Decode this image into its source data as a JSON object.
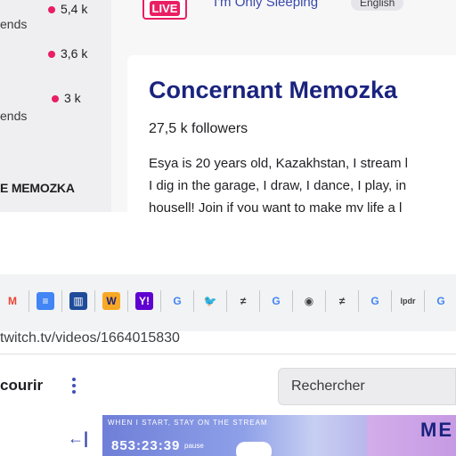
{
  "sidebar": {
    "channels": [
      {
        "viewers": "5,4 k",
        "label": "ends"
      },
      {
        "viewers": "3,6 k"
      },
      {
        "viewers": "3 k",
        "label": "ends"
      }
    ],
    "section_heading": "E MEMOZKA"
  },
  "stream": {
    "live_badge": "LIVE",
    "title": "I'm Only Sleeping",
    "language": "English"
  },
  "about": {
    "heading": "Concernant Memozka",
    "followers": "27,5 k followers",
    "bio_lines": [
      "Esya is 20 years old, Kazakhstan, I stream l",
      "I dig in the garage, I draw, I dance, I play, in",
      "housell! Join if you want to make my life a l"
    ]
  },
  "bookmarks": [
    {
      "icon": "gmail-icon",
      "glyph": "M",
      "color": "#ea4335",
      "bg": "transparent"
    },
    {
      "icon": "docs-icon",
      "glyph": "≡",
      "color": "#ffffff",
      "bg": "#4285f4"
    },
    {
      "icon": "trello-icon",
      "glyph": "▥",
      "color": "#ffffff",
      "bg": "#1e4c9a"
    },
    {
      "icon": "bookmark-w-icon",
      "glyph": "W",
      "color": "#1a237e",
      "bg": "#f9a825"
    },
    {
      "icon": "yahoo-icon",
      "glyph": "Y!",
      "color": "#ffffff",
      "bg": "#5f01d1"
    },
    {
      "icon": "google-icon",
      "glyph": "G",
      "color": "#4285f4",
      "bg": "transparent"
    },
    {
      "icon": "twitter-icon",
      "glyph": "🐦",
      "color": "#1da1f2",
      "bg": "transparent"
    },
    {
      "icon": "not-equal-icon",
      "glyph": "≠",
      "color": "#3c4043",
      "bg": "transparent"
    },
    {
      "icon": "google-icon",
      "glyph": "G",
      "color": "#4285f4",
      "bg": "transparent"
    },
    {
      "icon": "globe-icon",
      "glyph": "◉",
      "color": "#3c4043",
      "bg": "transparent"
    },
    {
      "icon": "not-equal-icon",
      "glyph": "≠",
      "color": "#3c4043",
      "bg": "transparent"
    },
    {
      "icon": "google-icon",
      "glyph": "G",
      "color": "#4285f4",
      "bg": "transparent"
    },
    {
      "icon": "lpdr-icon",
      "glyph": "lpdr",
      "color": "#3c4043",
      "bg": "transparent"
    },
    {
      "icon": "google-icon",
      "glyph": "G",
      "color": "#4285f4",
      "bg": "transparent"
    }
  ],
  "address_bar": {
    "url": "twitch.tv/videos/1664015830"
  },
  "twitch_nav": {
    "browse_label": "courir",
    "search_placeholder": "Rechercher",
    "collapse_glyph": "←|"
  },
  "video_preview": {
    "header_text": "WHEN I START, STAY ON THE STREAM",
    "timer": "853:23:39",
    "sub_text": "pause",
    "brand": "ME"
  },
  "colors": {
    "accent": "#e91e63",
    "link": "#3949ab",
    "heading": "#1a237e"
  }
}
